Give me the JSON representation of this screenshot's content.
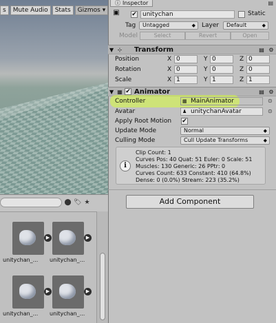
{
  "scene": {
    "toolbar": {
      "fx": "s",
      "mute": "Mute Audio",
      "stats": "Stats",
      "gizmos": "Gizmos",
      "gizmos_arrow": "▾"
    }
  },
  "project": {
    "toolbar_icons": [
      "⬤",
      "🏷",
      "★"
    ],
    "assets": [
      {
        "label": "unitychan_..."
      },
      {
        "label": "unitychan_..."
      },
      {
        "label": "unitychan_..."
      },
      {
        "label": "unitychan_..."
      }
    ]
  },
  "inspector": {
    "tab_label": "Inspector",
    "object": {
      "name": "unitychan",
      "static_label": "Static",
      "tag_label": "Tag",
      "tag_value": "Untagged",
      "layer_label": "Layer",
      "layer_value": "Default",
      "model_label": "Model",
      "select": "Select",
      "revert": "Revert",
      "open": "Open"
    },
    "transform": {
      "title": "Transform",
      "rows": [
        {
          "label": "Position",
          "x": "0",
          "y": "0",
          "z": "0"
        },
        {
          "label": "Rotation",
          "x": "0",
          "y": "0",
          "z": "0"
        },
        {
          "label": "Scale",
          "x": "1",
          "y": "1",
          "z": "1"
        }
      ],
      "axis_x": "X",
      "axis_y": "Y",
      "axis_z": "Z"
    },
    "animator": {
      "title": "Animator",
      "controller_label": "Controller",
      "controller_value": "MainAnimator",
      "avatar_label": "Avatar",
      "avatar_value": "unitychanAvatar",
      "apply_root_motion_label": "Apply Root Motion",
      "apply_root_motion_checked": "✔",
      "update_mode_label": "Update Mode",
      "update_mode_value": "Normal",
      "culling_mode_label": "Culling Mode",
      "culling_mode_value": "Cull Update Transforms",
      "info": [
        "Clip Count: 1",
        "Curves Pos: 40 Quat: 51 Euler: 0 Scale: 51",
        "Muscles: 130 Generic: 26 PPtr: 0",
        "Curves Count: 633 Constant: 410 (64.8%)",
        "Dense: 0 (0.0%) Stream: 223 (35.2%)"
      ]
    },
    "add_component": "Add Component"
  },
  "colors": {
    "highlight": "#d9ff3d",
    "panel_bg": "#c2c2c2"
  }
}
